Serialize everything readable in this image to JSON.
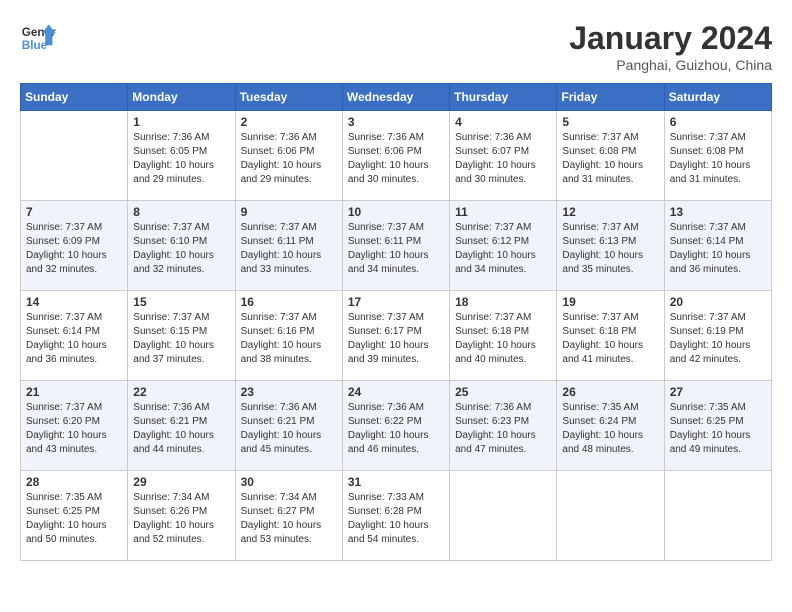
{
  "header": {
    "logo_general": "General",
    "logo_blue": "Blue",
    "month_year": "January 2024",
    "location": "Panghai, Guizhou, China"
  },
  "weekdays": [
    "Sunday",
    "Monday",
    "Tuesday",
    "Wednesday",
    "Thursday",
    "Friday",
    "Saturday"
  ],
  "weeks": [
    [
      {
        "day": "",
        "sunrise": "",
        "sunset": "",
        "daylight": ""
      },
      {
        "day": "1",
        "sunrise": "7:36 AM",
        "sunset": "6:05 PM",
        "daylight": "10 hours and 29 minutes."
      },
      {
        "day": "2",
        "sunrise": "7:36 AM",
        "sunset": "6:06 PM",
        "daylight": "10 hours and 29 minutes."
      },
      {
        "day": "3",
        "sunrise": "7:36 AM",
        "sunset": "6:06 PM",
        "daylight": "10 hours and 30 minutes."
      },
      {
        "day": "4",
        "sunrise": "7:36 AM",
        "sunset": "6:07 PM",
        "daylight": "10 hours and 30 minutes."
      },
      {
        "day": "5",
        "sunrise": "7:37 AM",
        "sunset": "6:08 PM",
        "daylight": "10 hours and 31 minutes."
      },
      {
        "day": "6",
        "sunrise": "7:37 AM",
        "sunset": "6:08 PM",
        "daylight": "10 hours and 31 minutes."
      }
    ],
    [
      {
        "day": "7",
        "sunrise": "7:37 AM",
        "sunset": "6:09 PM",
        "daylight": "10 hours and 32 minutes."
      },
      {
        "day": "8",
        "sunrise": "7:37 AM",
        "sunset": "6:10 PM",
        "daylight": "10 hours and 32 minutes."
      },
      {
        "day": "9",
        "sunrise": "7:37 AM",
        "sunset": "6:11 PM",
        "daylight": "10 hours and 33 minutes."
      },
      {
        "day": "10",
        "sunrise": "7:37 AM",
        "sunset": "6:11 PM",
        "daylight": "10 hours and 34 minutes."
      },
      {
        "day": "11",
        "sunrise": "7:37 AM",
        "sunset": "6:12 PM",
        "daylight": "10 hours and 34 minutes."
      },
      {
        "day": "12",
        "sunrise": "7:37 AM",
        "sunset": "6:13 PM",
        "daylight": "10 hours and 35 minutes."
      },
      {
        "day": "13",
        "sunrise": "7:37 AM",
        "sunset": "6:14 PM",
        "daylight": "10 hours and 36 minutes."
      }
    ],
    [
      {
        "day": "14",
        "sunrise": "7:37 AM",
        "sunset": "6:14 PM",
        "daylight": "10 hours and 36 minutes."
      },
      {
        "day": "15",
        "sunrise": "7:37 AM",
        "sunset": "6:15 PM",
        "daylight": "10 hours and 37 minutes."
      },
      {
        "day": "16",
        "sunrise": "7:37 AM",
        "sunset": "6:16 PM",
        "daylight": "10 hours and 38 minutes."
      },
      {
        "day": "17",
        "sunrise": "7:37 AM",
        "sunset": "6:17 PM",
        "daylight": "10 hours and 39 minutes."
      },
      {
        "day": "18",
        "sunrise": "7:37 AM",
        "sunset": "6:18 PM",
        "daylight": "10 hours and 40 minutes."
      },
      {
        "day": "19",
        "sunrise": "7:37 AM",
        "sunset": "6:18 PM",
        "daylight": "10 hours and 41 minutes."
      },
      {
        "day": "20",
        "sunrise": "7:37 AM",
        "sunset": "6:19 PM",
        "daylight": "10 hours and 42 minutes."
      }
    ],
    [
      {
        "day": "21",
        "sunrise": "7:37 AM",
        "sunset": "6:20 PM",
        "daylight": "10 hours and 43 minutes."
      },
      {
        "day": "22",
        "sunrise": "7:36 AM",
        "sunset": "6:21 PM",
        "daylight": "10 hours and 44 minutes."
      },
      {
        "day": "23",
        "sunrise": "7:36 AM",
        "sunset": "6:21 PM",
        "daylight": "10 hours and 45 minutes."
      },
      {
        "day": "24",
        "sunrise": "7:36 AM",
        "sunset": "6:22 PM",
        "daylight": "10 hours and 46 minutes."
      },
      {
        "day": "25",
        "sunrise": "7:36 AM",
        "sunset": "6:23 PM",
        "daylight": "10 hours and 47 minutes."
      },
      {
        "day": "26",
        "sunrise": "7:35 AM",
        "sunset": "6:24 PM",
        "daylight": "10 hours and 48 minutes."
      },
      {
        "day": "27",
        "sunrise": "7:35 AM",
        "sunset": "6:25 PM",
        "daylight": "10 hours and 49 minutes."
      }
    ],
    [
      {
        "day": "28",
        "sunrise": "7:35 AM",
        "sunset": "6:25 PM",
        "daylight": "10 hours and 50 minutes."
      },
      {
        "day": "29",
        "sunrise": "7:34 AM",
        "sunset": "6:26 PM",
        "daylight": "10 hours and 52 minutes."
      },
      {
        "day": "30",
        "sunrise": "7:34 AM",
        "sunset": "6:27 PM",
        "daylight": "10 hours and 53 minutes."
      },
      {
        "day": "31",
        "sunrise": "7:33 AM",
        "sunset": "6:28 PM",
        "daylight": "10 hours and 54 minutes."
      },
      {
        "day": "",
        "sunrise": "",
        "sunset": "",
        "daylight": ""
      },
      {
        "day": "",
        "sunrise": "",
        "sunset": "",
        "daylight": ""
      },
      {
        "day": "",
        "sunrise": "",
        "sunset": "",
        "daylight": ""
      }
    ]
  ],
  "labels": {
    "sunrise": "Sunrise:",
    "sunset": "Sunset:",
    "daylight": "Daylight:"
  }
}
